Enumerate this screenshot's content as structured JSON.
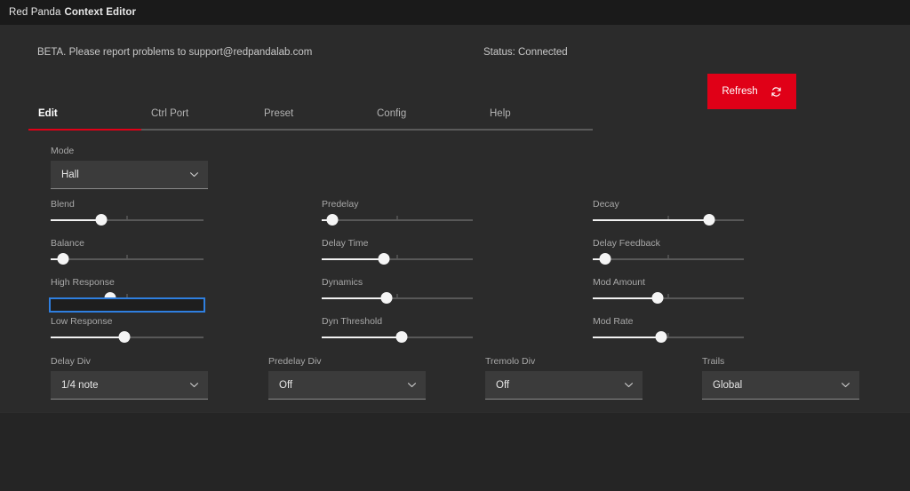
{
  "window": {
    "title_light": "Red Panda",
    "title_bold": "Context Editor"
  },
  "header": {
    "beta_notice": "BETA. Please report problems to support@redpandalab.com",
    "status": "Status: Connected",
    "refresh_label": "Refresh",
    "refresh_icon": "refresh-icon",
    "accent_color": "#e00017"
  },
  "tabs": [
    {
      "label": "Edit",
      "active": true
    },
    {
      "label": "Ctrl Port",
      "active": false
    },
    {
      "label": "Preset",
      "active": false
    },
    {
      "label": "Config",
      "active": false
    },
    {
      "label": "Help",
      "active": false
    }
  ],
  "mode": {
    "label": "Mode",
    "value": "Hall",
    "chevron_icon": "chevron-down-icon"
  },
  "sliders": {
    "left": [
      {
        "label": "Blend",
        "value": 33,
        "focused": false
      },
      {
        "label": "Balance",
        "value": 8,
        "focused": false
      },
      {
        "label": "High Response",
        "value": 39,
        "focused": true
      },
      {
        "label": "Low Response",
        "value": 48,
        "focused": false
      }
    ],
    "middle": [
      {
        "label": "Predelay",
        "value": 7,
        "focused": false
      },
      {
        "label": "Delay Time",
        "value": 41,
        "focused": false
      },
      {
        "label": "Dynamics",
        "value": 43,
        "focused": false
      },
      {
        "label": "Dyn Threshold",
        "value": 53,
        "focused": false
      }
    ],
    "right": [
      {
        "label": "Decay",
        "value": 77,
        "focused": false
      },
      {
        "label": "Delay Feedback",
        "value": 8,
        "focused": false
      },
      {
        "label": "Mod Amount",
        "value": 43,
        "focused": false
      },
      {
        "label": "Mod Rate",
        "value": 45,
        "focused": false
      }
    ]
  },
  "bottom_selects": [
    {
      "label": "Delay Div",
      "value": "1/4 note"
    },
    {
      "label": "Predelay Div",
      "value": "Off"
    },
    {
      "label": "Tremolo Div",
      "value": "Off"
    },
    {
      "label": "Trails",
      "value": "Global"
    }
  ]
}
